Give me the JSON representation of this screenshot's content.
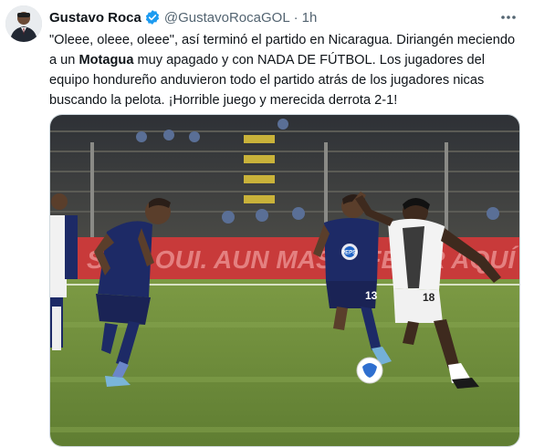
{
  "tweet": {
    "author_name": "Gustavo Roca",
    "handle": "@GustavoRocaGOL",
    "separator": "·",
    "time": "1h",
    "text_part1": "\"Oleee, oleee, oleee\", así terminó el partido en Nicaragua. Diriangén meciendo a un ",
    "text_bold": "Motagua",
    "text_part2": " muy apagado y con NADA DE FÚTBOL. Los jugadores del equipo hondureño anduvieron todo el partido atrás de los jugadores nicas buscando la pelota. ¡Horrible juego y merecida derrota 2-1!"
  },
  "photo": {
    "banner_text": "SAR, OUI. AUN MAS DIFE ...R AQUÍ",
    "shirt_sponsor": "PEPSI",
    "player_numbers": [
      "13",
      "18"
    ]
  },
  "icons": {
    "verified": "verified-badge-icon",
    "more": "more-options-icon"
  },
  "colors": {
    "accent": "#1d9bf0",
    "text": "#0f1419",
    "secondary": "#536471",
    "pitch": "#6f8f3c",
    "banner": "#c83a3a",
    "motagua_kit": "#1d2a66"
  }
}
